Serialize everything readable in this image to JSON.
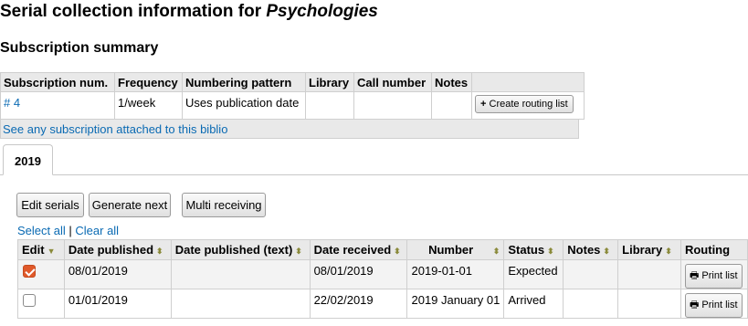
{
  "page": {
    "title_prefix": "Serial collection information for ",
    "title_italic": "Psychologies",
    "subscription_summary_heading": "Subscription summary"
  },
  "subscription_table": {
    "headers": [
      "Subscription num.",
      "Frequency",
      "Numbering pattern",
      "Library",
      "Call number",
      "Notes"
    ],
    "row": {
      "number": "# 4",
      "frequency": "1/week",
      "numbering_pattern": "Uses publication date",
      "library": "",
      "call_number": "",
      "notes": "",
      "create_routing_label": "Create routing list"
    },
    "footer_link": "See any subscription attached to this biblio"
  },
  "tabs": [
    {
      "label": "2019"
    }
  ],
  "actions": {
    "edit_serials": "Edit serials",
    "generate_next": "Generate next",
    "multi_receiving": "Multi receiving",
    "select_all": "Select all",
    "separator": "|",
    "clear_all": "Clear all"
  },
  "serials_table": {
    "headers": [
      "Edit",
      "Date published",
      "Date published (text)",
      "Date received",
      "Number",
      "Status",
      "Notes",
      "Library",
      "Routing"
    ],
    "rows": [
      {
        "checked": true,
        "date_published": "08/01/2019",
        "date_published_text": "",
        "date_received": "08/01/2019",
        "number": "2019-01-01",
        "status": "Expected",
        "notes": "",
        "library": "",
        "routing": "Print list"
      },
      {
        "checked": false,
        "date_published": "01/01/2019",
        "date_published_text": "",
        "date_received": "22/02/2019",
        "number": "2019 January 01",
        "status": "Arrived",
        "notes": "",
        "library": "",
        "routing": "Print list"
      }
    ]
  },
  "icons": {
    "plus": "plus-icon",
    "print": "print-icon",
    "sort": "sort-arrows-icon"
  },
  "colors": {
    "link": "#0a6ab3",
    "header_bg": "#e9e9e9",
    "checkbox_checked": "#e0592a"
  }
}
